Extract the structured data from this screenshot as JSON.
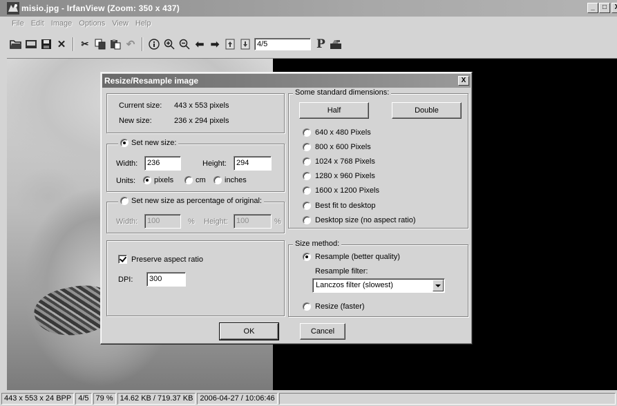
{
  "window": {
    "title": "misio.jpg - IrfanView (Zoom: 350 x 437)",
    "controls": {
      "minimize": "_",
      "maximize": "□",
      "close": "X"
    }
  },
  "menu": [
    "File",
    "Edit",
    "Image",
    "Options",
    "View",
    "Help"
  ],
  "toolbar": {
    "icons": [
      "open-folder-icon",
      "slideshow-icon",
      "save-disk-icon",
      "delete-x-icon",
      "cut-scissors-icon",
      "copy-icon",
      "paste-icon",
      "undo-icon",
      "info-icon",
      "zoom-in-icon",
      "zoom-out-icon",
      "previous-arrow-icon",
      "next-arrow-icon",
      "first-file-icon",
      "last-file-icon"
    ],
    "page_value": "4/5",
    "print_label": "P"
  },
  "dialog": {
    "title": "Resize/Resample image",
    "close": "X",
    "size_info": {
      "current_label": "Current size:",
      "current_value": "443  x  553  pixels",
      "new_label": "New size:",
      "new_value": "236  x  294  pixels"
    },
    "set_new_size": {
      "legend": "Set new size:",
      "width_label": "Width:",
      "width_value": "236",
      "height_label": "Height:",
      "height_value": "294",
      "units_label": "Units:",
      "units": [
        {
          "label": "pixels",
          "selected": true
        },
        {
          "label": "cm",
          "selected": false
        },
        {
          "label": "inches",
          "selected": false
        }
      ]
    },
    "percentage": {
      "legend": "Set new size as percentage of original:",
      "width_label": "Width:",
      "width_value": "100",
      "width_unit": "%",
      "height_label": "Height:",
      "height_value": "100",
      "height_unit": "%"
    },
    "options": {
      "preserve_label": "Preserve aspect ratio",
      "preserve_checked": true,
      "dpi_label": "DPI:",
      "dpi_value": "300"
    },
    "standard_dims": {
      "legend": "Some standard dimensions:",
      "half_label": "Half",
      "double_label": "Double",
      "choices": [
        "640 x 480 Pixels",
        "800 x 600 Pixels",
        "1024 x 768 Pixels",
        "1280 x 960 Pixels",
        "1600 x 1200 Pixels",
        "Best fit to desktop",
        "Desktop size (no aspect ratio)"
      ]
    },
    "size_method": {
      "legend": "Size method:",
      "resample_label": "Resample (better quality)",
      "filter_label": "Resample filter:",
      "filter_value": "Lanczos filter (slowest)",
      "resize_label": "Resize (faster)"
    },
    "ok_label": "OK",
    "cancel_label": "Cancel"
  },
  "status": [
    "443 x 553 x 24 BPP",
    "4/5",
    "79 %",
    "14.62 KB / 719.37 KB",
    "2006-04-27 / 10:06:46"
  ]
}
